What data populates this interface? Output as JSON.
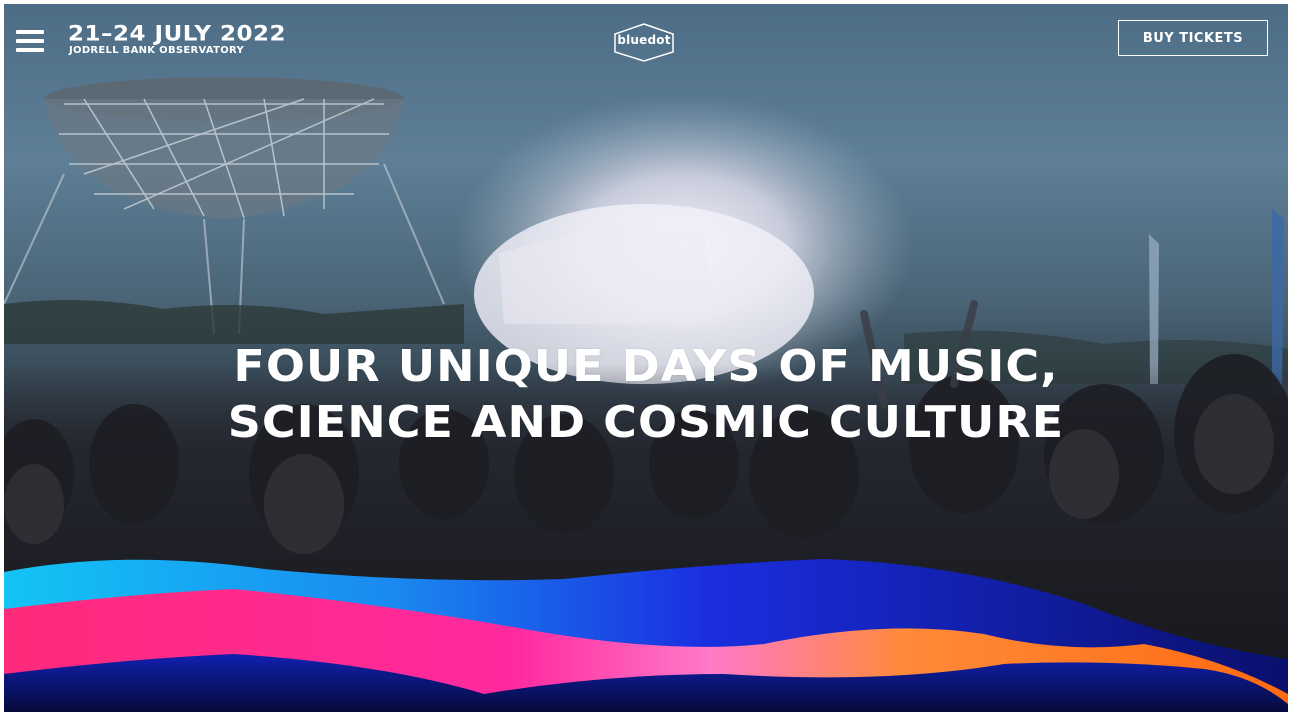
{
  "header": {
    "menu_icon": "hamburger-menu-icon",
    "dates": "21–24 JULY 2022",
    "venue": "JODRELL BANK OBSERVATORY",
    "logo_text": "bluedot",
    "buy_tickets_label": "BUY TICKETS"
  },
  "hero": {
    "headline_line1": "FOUR UNIQUE DAYS OF MUSIC,",
    "headline_line2": "SCIENCE AND COSMIC CULTURE"
  },
  "colors": {
    "wave_cyan": "#19b5f2",
    "wave_blue": "#1a2ee0",
    "wave_pink": "#ff2a8c",
    "wave_orange": "#ff7a1a",
    "wave_navy": "#0a0f5c"
  }
}
